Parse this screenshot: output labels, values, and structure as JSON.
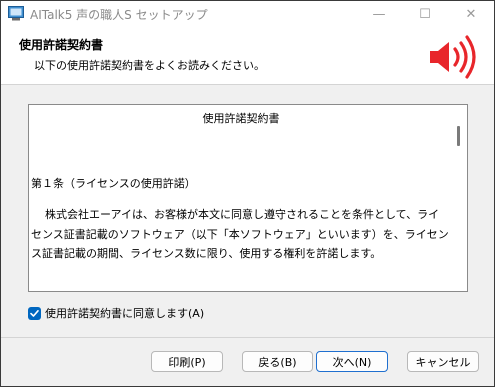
{
  "window": {
    "title": "AITalk5 声の職人S セットアップ",
    "minimize_glyph": "—",
    "maximize_glyph": "☐",
    "close_glyph": "✕"
  },
  "header": {
    "title": "使用許諾契約書",
    "subtitle": "以下の使用許諾契約書をよくお読みください。",
    "icon": "speaker-icon",
    "accent_color": "#e8262b"
  },
  "license": {
    "heading": "使用許諾契約書",
    "article_title": "第１条（ライセンスの使用許諾）",
    "paragraph": "株式会社エーアイは、お客様が本文に同意し遵守されることを条件として、ライセンス証書記載のソフトウェア（以下「本ソフトウェア」といいます）を、ライセンス証書記載の期間、ライセンス数に限り、使用する権利を許諾します。"
  },
  "agreement": {
    "checked": true,
    "label": "使用許諾契約書に同意します(A)",
    "check_color": "#0067c0"
  },
  "buttons": {
    "print": "印刷(P)",
    "back": "戻る(B)",
    "next": "次へ(N)",
    "cancel": "キャンセル"
  }
}
